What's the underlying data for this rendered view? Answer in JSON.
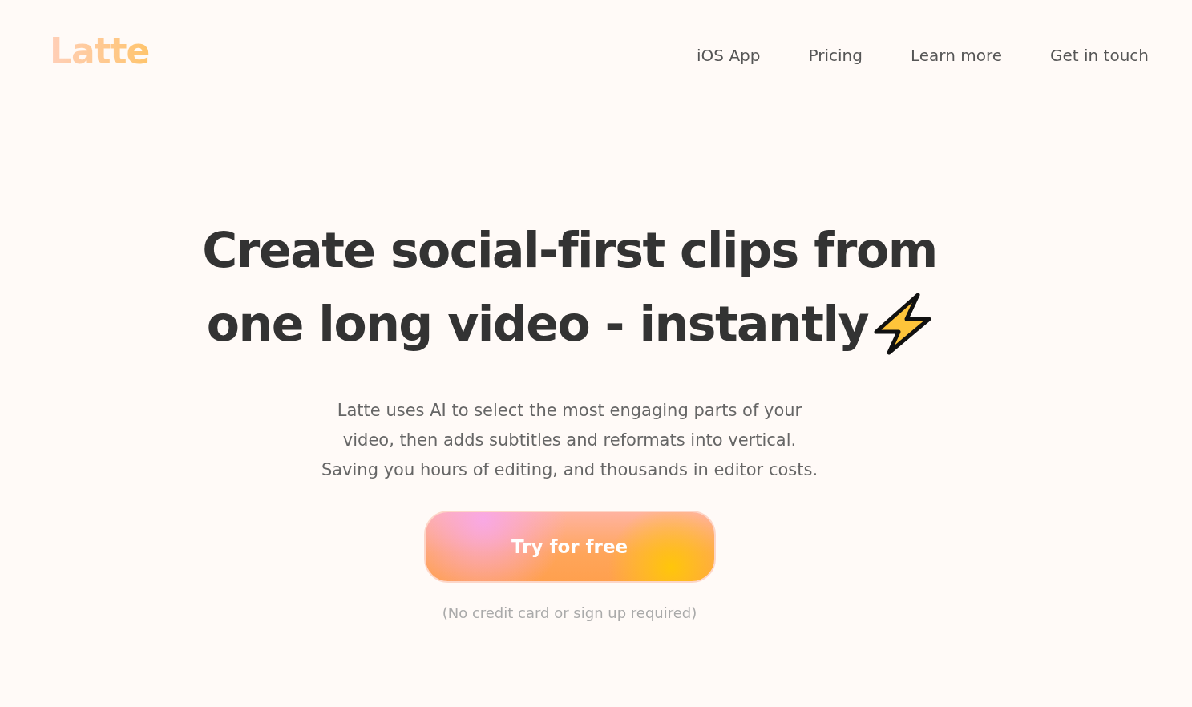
{
  "logo": "Latte",
  "nav": [
    "iOS App",
    "Pricing",
    "Learn more",
    "Get in touch"
  ],
  "headline": [
    "Create social-first clips from",
    "one long video - instantly"
  ],
  "description": [
    "Latte uses AI to select the most engaging parts of your",
    "video, then adds subtitles and reformats into vertical.",
    "Saving you hours of editing, and thousands in editor costs."
  ],
  "cta": "Try for free",
  "note": "(No credit card or sign up required)"
}
